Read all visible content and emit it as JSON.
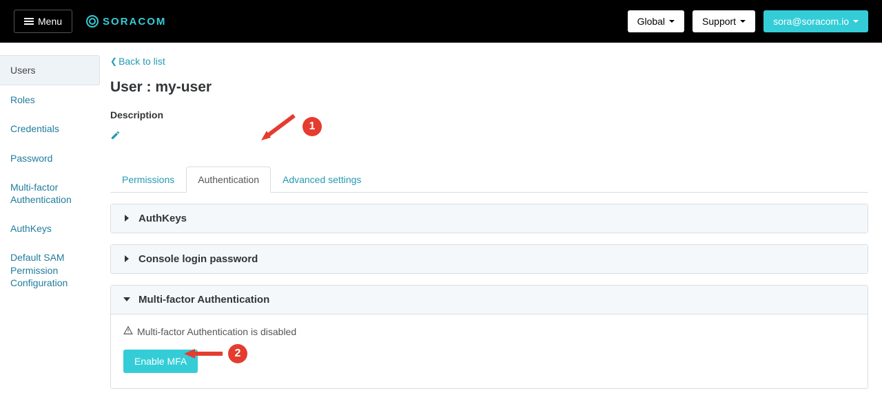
{
  "header": {
    "menu_label": "Menu",
    "brand": "SORACOM",
    "global_label": "Global",
    "support_label": "Support",
    "account_label": "sora@soracom.io"
  },
  "sidebar": {
    "items": [
      {
        "label": "Users",
        "active": true
      },
      {
        "label": "Roles"
      },
      {
        "label": "Credentials"
      },
      {
        "label": "Password"
      },
      {
        "label": "Multi-factor Authentication"
      },
      {
        "label": "AuthKeys"
      },
      {
        "label": "Default SAM Permission Configuration"
      }
    ]
  },
  "main": {
    "back_label": "Back to list",
    "user_title": "User : my-user",
    "description_heading": "Description",
    "tabs": [
      {
        "label": "Permissions"
      },
      {
        "label": "Authentication",
        "active": true
      },
      {
        "label": "Advanced settings"
      }
    ],
    "panels": {
      "authkeys": "AuthKeys",
      "password": "Console login password",
      "mfa": "Multi-factor Authentication"
    },
    "mfa_status": "Multi-factor Authentication is disabled",
    "enable_mfa_label": "Enable MFA"
  },
  "annotations": {
    "one": "1",
    "two": "2"
  }
}
